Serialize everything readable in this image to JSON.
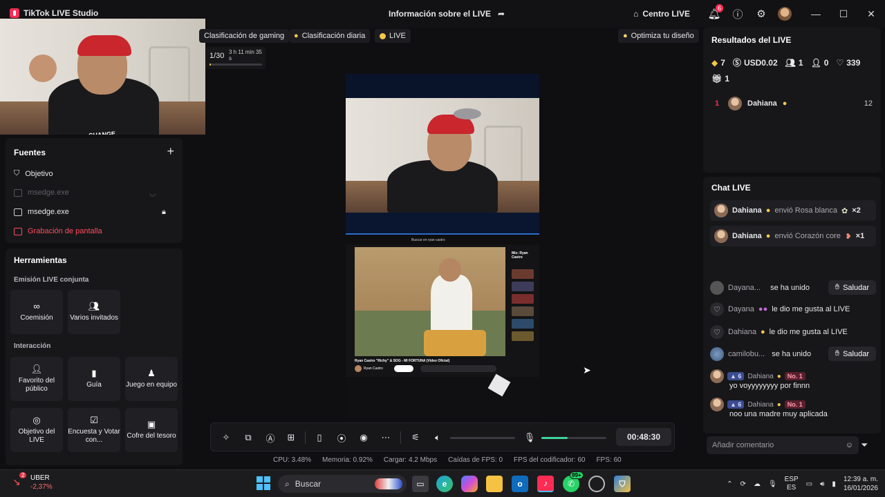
{
  "app": {
    "title": "TikTok LIVE Studio",
    "center_title": "Información sobre el LIVE"
  },
  "titlebar": {
    "centro": "Centro LIVE",
    "notif_count": "6"
  },
  "tags": {
    "gaming": "Clasificación de gaming",
    "daily": "Clasificación diaria",
    "live": "LIVE",
    "optimize": "Optimiza tu diseño"
  },
  "goal": {
    "count": "1/30",
    "elapsed": "3 h 11 min 35 s",
    "progress": 0.03
  },
  "sources": {
    "title": "Fuentes",
    "items": [
      {
        "label": "Objetivo"
      },
      {
        "label": "msedge.exe"
      },
      {
        "label": "msedge.exe"
      },
      {
        "label": "Grabación de pantalla"
      }
    ]
  },
  "tools": {
    "title": "Herramientas",
    "section_collab": "Emisión LIVE conjunta",
    "section_interaction": "Interacción",
    "items": [
      {
        "label": "Coemisión",
        "icon": "link-icon"
      },
      {
        "label": "Varios invitados",
        "icon": "group-icon"
      },
      {
        "label": "Favorito del público",
        "icon": "star-user-icon"
      },
      {
        "label": "Guía",
        "icon": "guide-icon"
      },
      {
        "label": "Juego en equipo",
        "icon": "team-icon"
      },
      {
        "label": "Objetivo del LIVE",
        "icon": "target-icon"
      },
      {
        "label": "Encuesta y Votar con...",
        "icon": "poll-icon"
      },
      {
        "label": "Cofre del tesoro",
        "icon": "chest-icon"
      }
    ]
  },
  "preview": {
    "yt_search": "Buscar en ryan castro",
    "yt_title": "Ryan Castro \"Richy\" & SOG - MI FORTUNA (Video Oficial)",
    "yt_channel": "Ryan Castro",
    "yt_side_title": "Mix: Ryan Castro"
  },
  "controls": {
    "timer": "00:48:30",
    "volume": 0.0,
    "mic_level": 0.4
  },
  "stats": {
    "cpu": "CPU: 3.48%",
    "memory": "Memoria: 0.92%",
    "upload": "Cargar: 4.2 Mbps",
    "fps_drops": "Caídas de FPS: 0",
    "encoder_fps": "FPS del codificador: 60",
    "fps": "FPS: 60"
  },
  "results": {
    "title": "Resultados del LIVE",
    "diamonds": "7",
    "money": "USD0.02",
    "viewers": "1",
    "new_followers": "0",
    "likes": "339",
    "gifts": "1",
    "ranking": [
      {
        "rank": "1",
        "name": "Dahiana",
        "score": "12"
      }
    ]
  },
  "chat": {
    "title": "Chat LIVE",
    "gifts": [
      {
        "name": "Dahiana",
        "text": "envió Rosa blanca",
        "mult": "×2"
      },
      {
        "name": "Dahiana",
        "text": "envió Corazón coreano",
        "mult": "×1"
      }
    ],
    "events": [
      {
        "name": "Dayana...",
        "text": "se ha unido",
        "button": "Saludar"
      },
      {
        "name": "Dayana",
        "text": "le dio me gusta al LIVE"
      },
      {
        "name": "Dahiana",
        "text": "le dio me gusta al LIVE"
      },
      {
        "name": "camilobu...",
        "text": "se ha unido",
        "button": "Saludar"
      }
    ],
    "messages": [
      {
        "level": "6",
        "name": "Dahiana",
        "badge": "No. 1",
        "text": "yo voyyyyyyyy por finnn"
      },
      {
        "level": "6",
        "name": "Dahiana",
        "badge": "No. 1",
        "text": "noo una madre muy aplicada"
      }
    ],
    "input_placeholder": "Añadir comentario"
  },
  "taskbar": {
    "ticker_name": "UBER",
    "ticker_change": "-2,37%",
    "ticker_badge": "2",
    "search": "Buscar",
    "whatsapp_badge": "99+",
    "lang": "ESP",
    "lang2": "ES",
    "time": "12:39 a. m.",
    "date": "16/01/2026"
  }
}
